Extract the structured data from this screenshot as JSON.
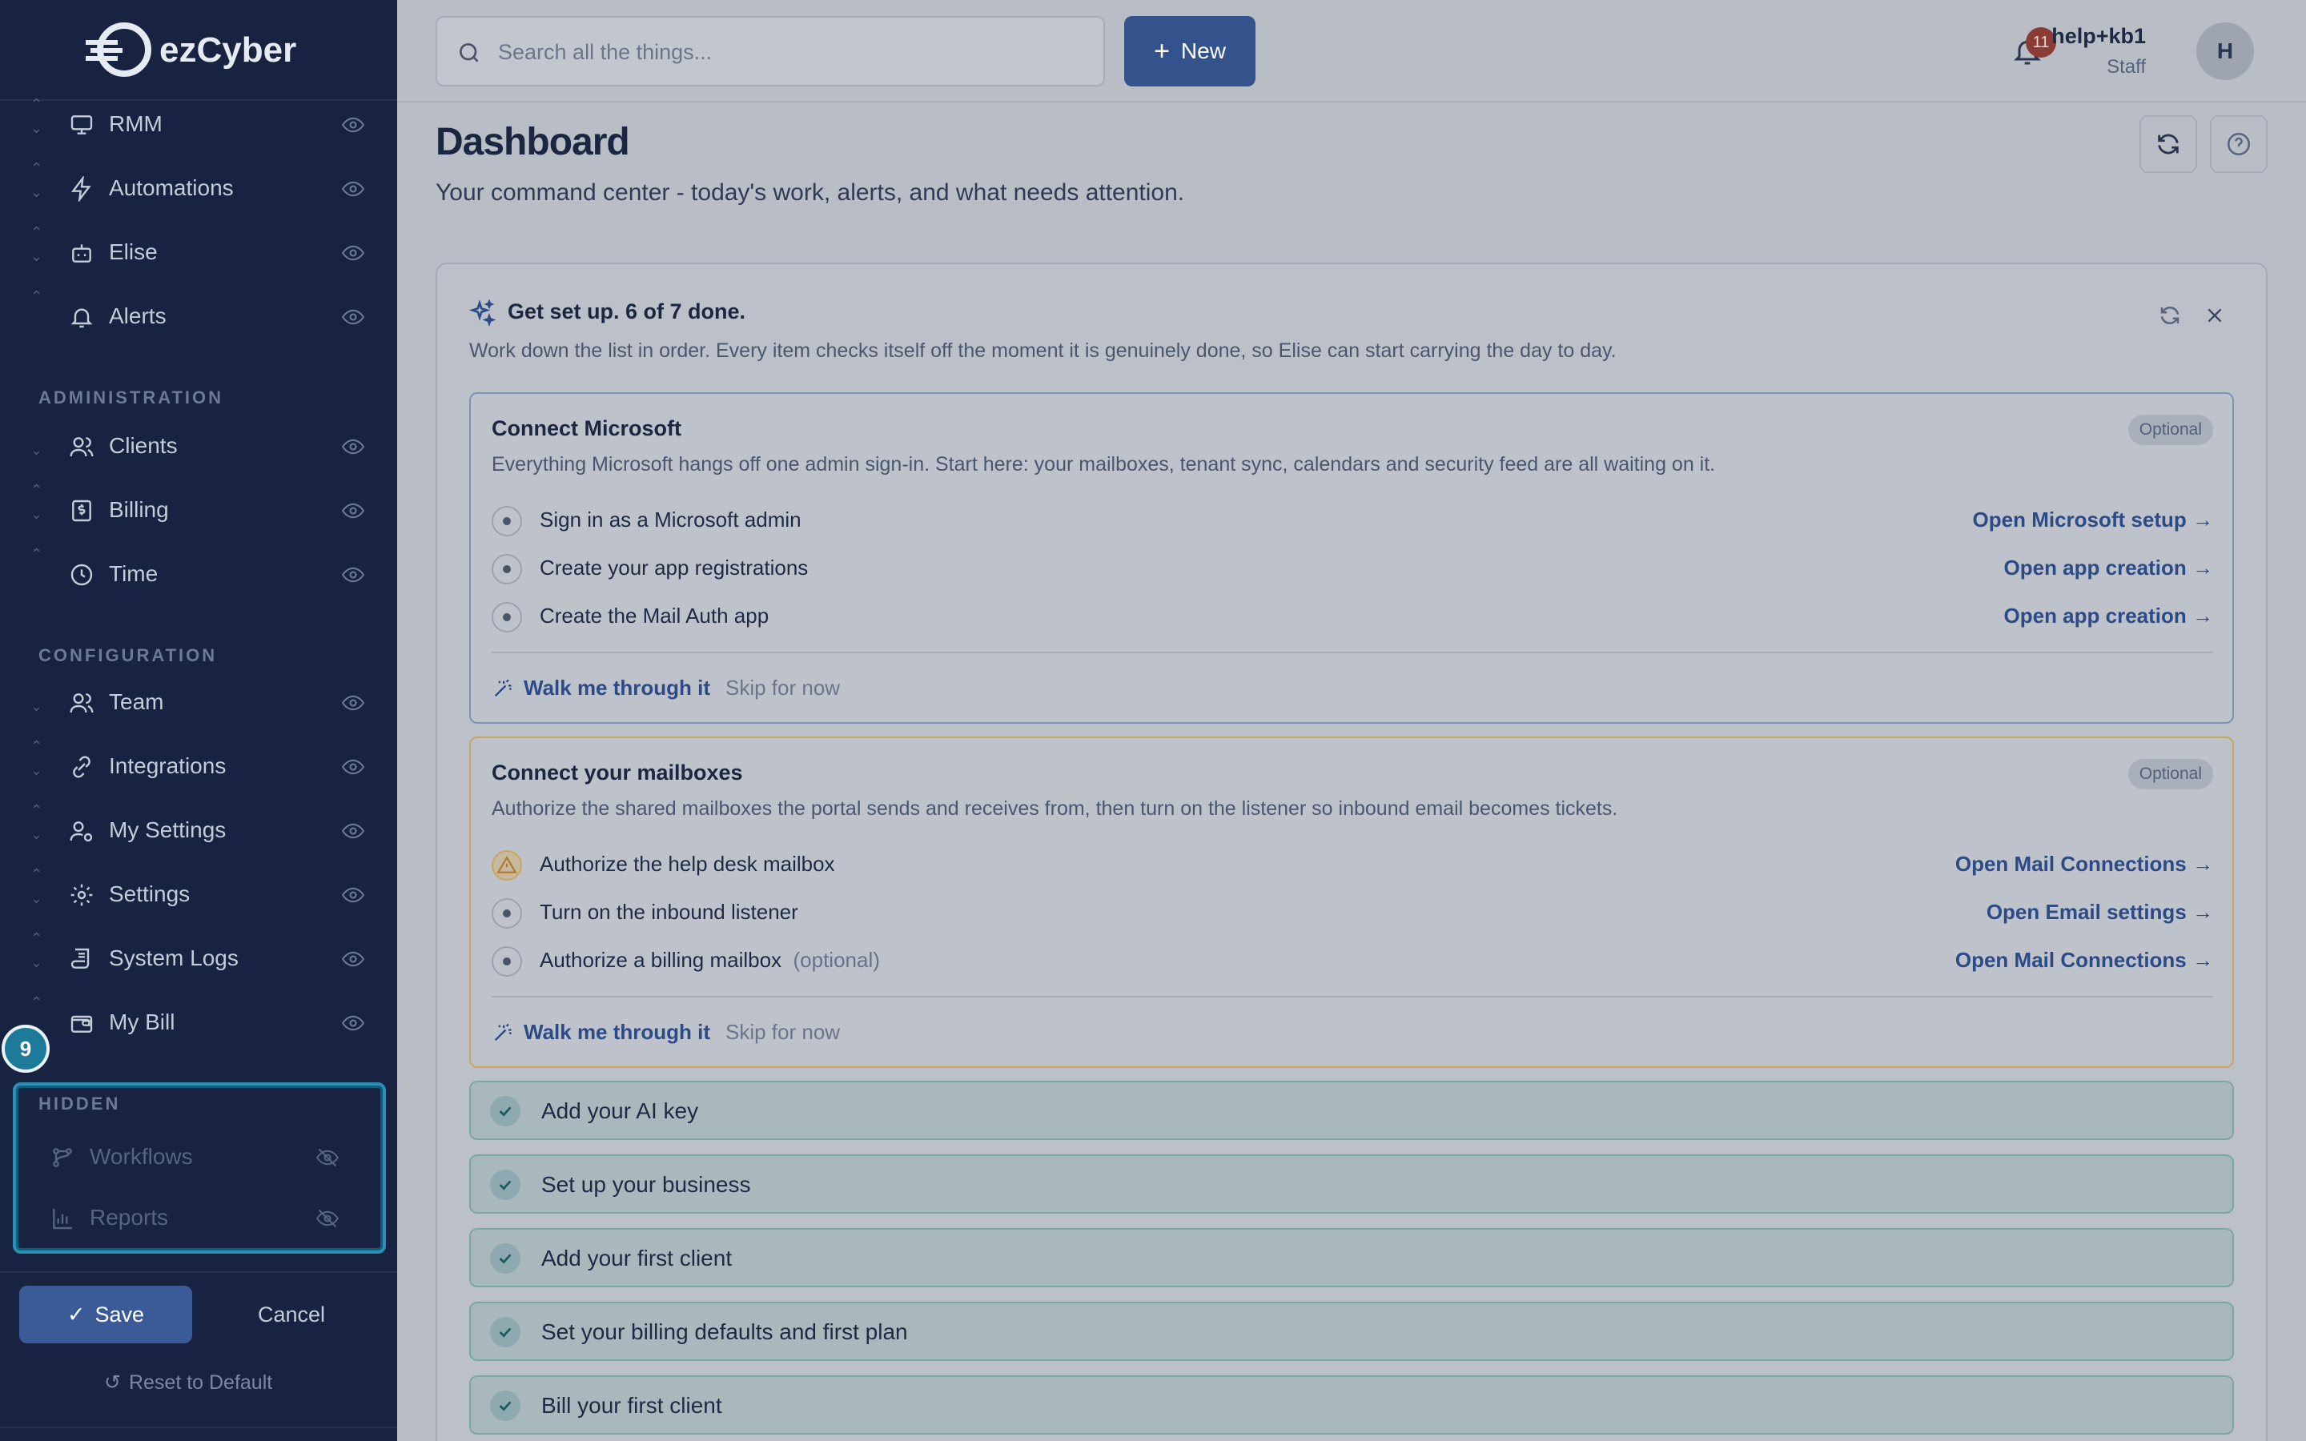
{
  "brand": {
    "logo_text": "ezCyber"
  },
  "sidebar": {
    "items": [
      {
        "label": "RMM",
        "icon": "monitor-icon"
      },
      {
        "label": "Automations",
        "icon": "lightning-icon"
      },
      {
        "label": "Elise",
        "icon": "bot-icon"
      },
      {
        "label": "Alerts",
        "icon": "bell-icon"
      }
    ],
    "admin_title": "ADMINISTRATION",
    "admin_items": [
      {
        "label": "Clients",
        "icon": "users-icon"
      },
      {
        "label": "Billing",
        "icon": "dollar-icon"
      },
      {
        "label": "Time",
        "icon": "clock-icon"
      }
    ],
    "config_title": "CONFIGURATION",
    "config_items": [
      {
        "label": "Team",
        "icon": "users-icon"
      },
      {
        "label": "Integrations",
        "icon": "link-icon"
      },
      {
        "label": "My Settings",
        "icon": "user-cog-icon"
      },
      {
        "label": "Settings",
        "icon": "gear-icon"
      },
      {
        "label": "System Logs",
        "icon": "scroll-icon"
      },
      {
        "label": "My Bill",
        "icon": "wallet-icon"
      }
    ],
    "hidden_title": "HIDDEN",
    "hidden_items": [
      {
        "label": "Workflows",
        "icon": "workflow-icon"
      },
      {
        "label": "Reports",
        "icon": "bar-chart-icon"
      }
    ],
    "step_badge": "9",
    "save_label": "Save",
    "cancel_label": "Cancel",
    "reset_label": "Reset to Default"
  },
  "header": {
    "search_placeholder": "Search all the things...",
    "new_label": "New",
    "notification_count": "11",
    "user_name": "help+kb1",
    "user_role": "Staff",
    "avatar_initial": "H"
  },
  "main": {
    "title": "Dashboard",
    "subtitle": "Your command center - today's work, alerts, and what needs attention."
  },
  "setup": {
    "title": "Get set up. 6 of 7 done.",
    "description": "Work down the list in order. Every item checks itself off the moment it is genuinely done, so Elise can start carrying the day to day.",
    "microsoft": {
      "title": "Connect Microsoft",
      "badge": "Optional",
      "description": "Everything Microsoft hangs off one admin sign-in. Start here: your mailboxes, tenant sync, calendars and security feed are all waiting on it.",
      "steps": [
        {
          "label": "Sign in as a Microsoft admin",
          "link": "Open Microsoft setup →"
        },
        {
          "label": "Create your app registrations",
          "link": "Open app creation →"
        },
        {
          "label": "Create the Mail Auth app",
          "link": "Open app creation →"
        }
      ],
      "walk_label": "Walk me through it",
      "skip_label": "Skip for now"
    },
    "mailboxes": {
      "title": "Connect your mailboxes",
      "badge": "Optional",
      "description": "Authorize the shared mailboxes the portal sends and receives from, then turn on the listener so inbound email becomes tickets.",
      "steps": [
        {
          "label": "Authorize the help desk mailbox",
          "link": "Open Mail Connections →",
          "status": "warning"
        },
        {
          "label": "Turn on the inbound listener",
          "link": "Open Email settings →"
        },
        {
          "label": "Authorize a billing mailbox",
          "optional": "(optional)",
          "link": "Open Mail Connections →"
        }
      ],
      "walk_label": "Walk me through it",
      "skip_label": "Skip for now"
    },
    "done_items": [
      "Add your AI key",
      "Set up your business",
      "Add your first client",
      "Set your billing defaults and first plan",
      "Bill your first client"
    ]
  },
  "colors": {
    "sidebar_bg": "#172341",
    "accent": "#34528c",
    "highlight": "#2c8fb3",
    "warning": "#c9a65c",
    "success": "#7aa6a3"
  }
}
